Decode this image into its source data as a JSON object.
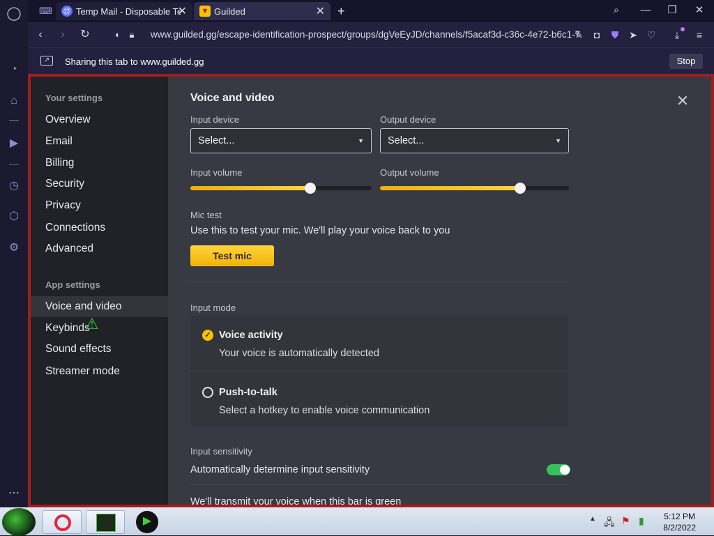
{
  "browser": {
    "tabs": [
      {
        "title": "Temp Mail - Disposable Ter"
      },
      {
        "title": "Guilded"
      }
    ],
    "url": "www.guilded.gg/escape-identification-prospect/groups/dgVeEyJD/channels/f5acaf3d-c36c-4e72-b6c1-7",
    "sharing_text": "Sharing this tab to www.guilded.gg",
    "stop_label": "Stop"
  },
  "settings_nav": {
    "your_settings_title": "Your settings",
    "your_settings_items": [
      "Overview",
      "Email",
      "Billing",
      "Security",
      "Privacy",
      "Connections",
      "Advanced"
    ],
    "app_settings_title": "App settings",
    "app_settings_items": [
      "Voice and video",
      "Keybinds",
      "Sound effects",
      "Streamer mode"
    ],
    "active_item": "Voice and video"
  },
  "panel": {
    "title": "Voice and video",
    "input_device_label": "Input device",
    "input_device_value": "Select...",
    "output_device_label": "Output device",
    "output_device_value": "Select...",
    "input_volume_label": "Input volume",
    "input_volume_level": 0.66,
    "output_volume_label": "Output volume",
    "output_volume_level": 0.74,
    "mic_test_label": "Mic test",
    "mic_test_desc": "Use this to test your mic. We'll play your voice back to you",
    "test_mic_button": "Test mic",
    "input_mode_label": "Input mode",
    "voice_activity_title": "Voice activity",
    "voice_activity_desc": "Your voice is automatically detected",
    "push_to_talk_title": "Push-to-talk",
    "push_to_talk_desc": "Select a hotkey to enable voice communication",
    "selected_mode": "Voice activity",
    "input_sensitivity_label": "Input sensitivity",
    "auto_sensitivity_text": "Automatically determine input sensitivity",
    "auto_sensitivity_on": true,
    "transmit_text": "We'll transmit your voice when this bar is green"
  },
  "taskbar": {
    "time": "5:12 PM",
    "date": "8/2/2022"
  },
  "colors": {
    "accent": "#f5c400",
    "frame_border": "#a11c1e",
    "toggle_on": "#36c25a"
  }
}
